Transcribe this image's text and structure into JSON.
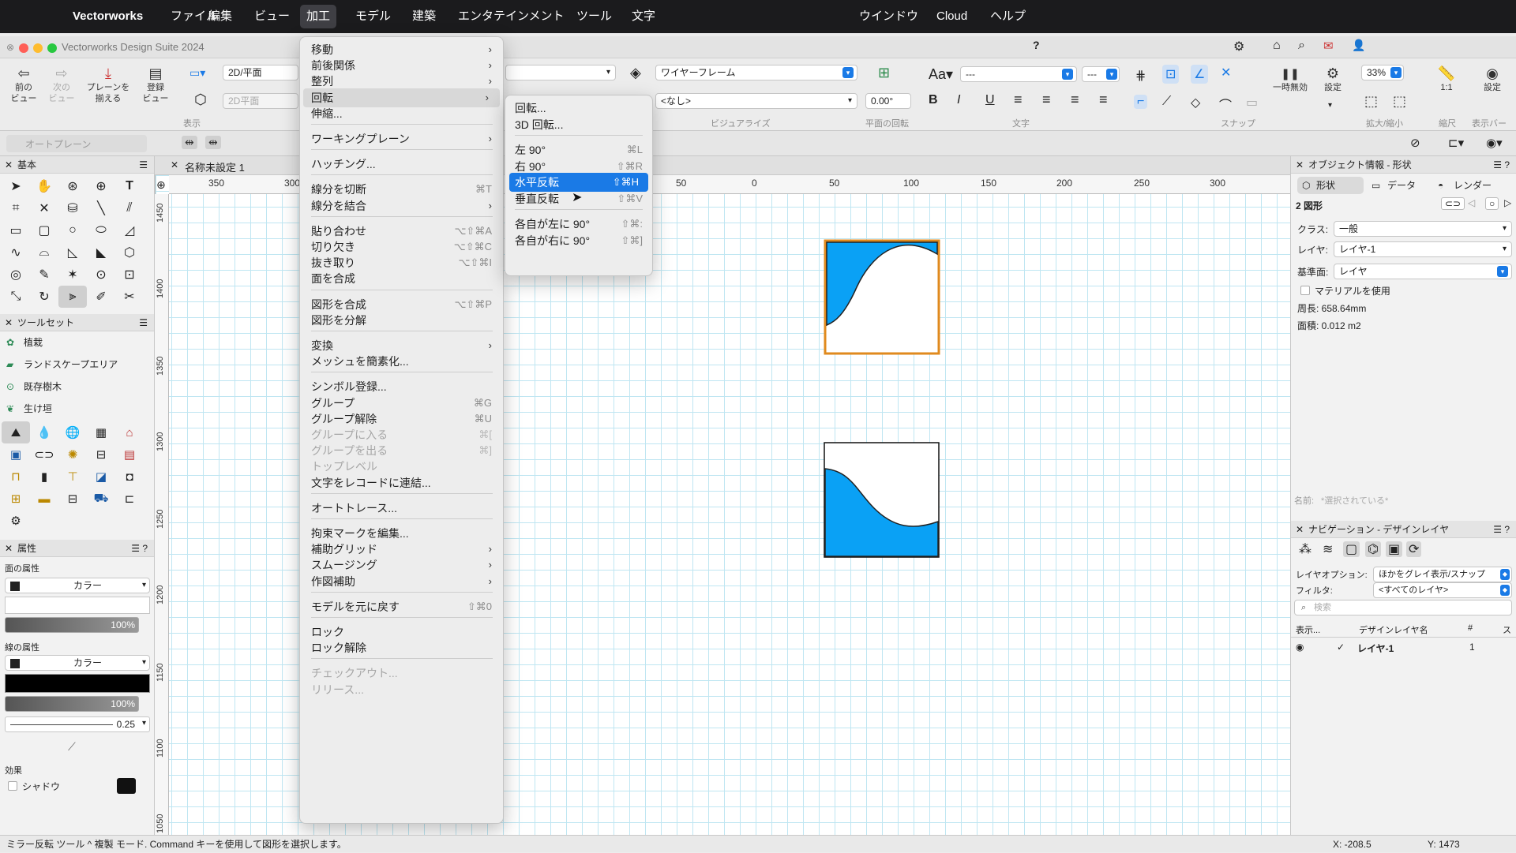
{
  "menubar": {
    "app": "Vectorworks",
    "items": [
      "ファイル",
      "編集",
      "ビュー",
      "加工",
      "モデル",
      "建築",
      "エンタテインメント",
      "ツール",
      "文字"
    ],
    "right": [
      "ウインドウ",
      "Cloud",
      "ヘルプ"
    ]
  },
  "window": {
    "title": "Vectorworks Design Suite 2024",
    "help": "?"
  },
  "toolbar": {
    "prev_view": "前の\nビュー",
    "next_view": "次の\nビュー",
    "align_plane": "プレーンを\n揃える",
    "save_view": "登録\nビュー",
    "view_mode": "2D/平面",
    "view_mode2": "2D平面",
    "section_view": "表示",
    "render_mode": "ワイヤーフレーム",
    "none_option": "<なし>",
    "rotation": "0.00°",
    "section_visualize": "ビジュアライズ",
    "section_plane_rot": "平面の回転",
    "font_dropdown": "---",
    "font_size": "---",
    "section_text": "文字",
    "section_snap": "スナップ",
    "pause_label": "一時無効",
    "settings_label": "設定",
    "zoom": "33%",
    "section_zoom": "拡大/縮小",
    "ratio": "1:1",
    "section_scale": "縮尺",
    "section_display": "表示バー",
    "settings2": "設定",
    "auto_plane": "オートプレーン"
  },
  "canvas": {
    "tab_title": "名称未設定 1",
    "ruler_top": [
      "350",
      "300",
      "50",
      "0",
      "50",
      "100",
      "150",
      "200",
      "250",
      "300"
    ],
    "ruler_left": [
      "1450",
      "1400",
      "1350",
      "1300",
      "1250",
      "1200",
      "1150",
      "1100",
      "1050"
    ]
  },
  "left_panel": {
    "basic_title": "基本",
    "toolset_title": "ツールセット",
    "toolsets": [
      "植栽",
      "ランドスケープエリア",
      "既存樹木",
      "生け垣"
    ],
    "attr_title": "属性",
    "fill_label": "面の属性",
    "fill_type": "カラー",
    "fill_opacity": "100%",
    "line_label": "線の属性",
    "line_type": "カラー",
    "line_opacity": "100%",
    "line_weight": "0.25",
    "effects_label": "効果",
    "shadow_label": "シャドウ"
  },
  "edit_menu": {
    "items": [
      {
        "label": "移動",
        "submenu": true
      },
      {
        "label": "前後関係",
        "submenu": true
      },
      {
        "label": "整列",
        "submenu": true
      },
      {
        "label": "回転",
        "submenu": true,
        "highlight": true
      },
      {
        "label": "伸縮..."
      },
      {
        "sep": true
      },
      {
        "label": "ワーキングプレーン",
        "submenu": true
      },
      {
        "sep": true
      },
      {
        "label": "ハッチング..."
      },
      {
        "sep": true
      },
      {
        "label": "線分を切断",
        "shortcut": "⌘T"
      },
      {
        "label": "線分を結合",
        "submenu": true
      },
      {
        "sep": true
      },
      {
        "label": "貼り合わせ",
        "shortcut": "⌥⇧⌘A"
      },
      {
        "label": "切り欠き",
        "shortcut": "⌥⇧⌘C"
      },
      {
        "label": "抜き取り",
        "shortcut": "⌥⇧⌘I"
      },
      {
        "label": "面を合成"
      },
      {
        "sep": true
      },
      {
        "label": "図形を合成",
        "shortcut": "⌥⇧⌘P"
      },
      {
        "label": "図形を分解"
      },
      {
        "sep": true
      },
      {
        "label": "変換",
        "submenu": true
      },
      {
        "label": "メッシュを簡素化..."
      },
      {
        "sep": true
      },
      {
        "label": "シンボル登録..."
      },
      {
        "label": "グループ",
        "shortcut": "⌘G"
      },
      {
        "label": "グループ解除",
        "shortcut": "⌘U"
      },
      {
        "label": "グループに入る",
        "shortcut": "⌘[",
        "disabled": true
      },
      {
        "label": "グループを出る",
        "shortcut": "⌘]",
        "disabled": true
      },
      {
        "label": "トップレベル",
        "disabled": true
      },
      {
        "label": "文字をレコードに連結..."
      },
      {
        "sep": true
      },
      {
        "label": "オートトレース..."
      },
      {
        "sep": true
      },
      {
        "label": "拘束マークを編集..."
      },
      {
        "label": "補助グリッド",
        "submenu": true
      },
      {
        "label": "スムージング",
        "submenu": true
      },
      {
        "label": "作図補助",
        "submenu": true
      },
      {
        "sep": true
      },
      {
        "label": "モデルを元に戻す",
        "shortcut": "⇧⌘0"
      },
      {
        "sep": true
      },
      {
        "label": "ロック"
      },
      {
        "label": "ロック解除"
      },
      {
        "sep": true
      },
      {
        "label": "チェックアウト...",
        "disabled": true
      },
      {
        "label": "リリース...",
        "disabled": true
      }
    ]
  },
  "rotate_submenu": {
    "items": [
      {
        "label": "回転..."
      },
      {
        "label": "3D 回転..."
      },
      {
        "sep": true
      },
      {
        "label": "左 90°",
        "shortcut": "⌘L"
      },
      {
        "label": "右 90°",
        "shortcut": "⇧⌘R"
      },
      {
        "label": "水平反転",
        "shortcut": "⇧⌘H",
        "highlight": true
      },
      {
        "label": "垂直反転",
        "shortcut": "⇧⌘V"
      },
      {
        "sep": true
      },
      {
        "label": "各自が左に 90°",
        "shortcut": "⇧⌘:"
      },
      {
        "label": "各自が右に 90°",
        "shortcut": "⇧⌘]"
      }
    ]
  },
  "right_panel": {
    "oi_title": "オブジェクト情報 - 形状",
    "tabs": [
      "形状",
      "データ",
      "レンダー"
    ],
    "selection": "2 図形",
    "class_label": "クラス:",
    "class_value": "一般",
    "layer_label": "レイヤ:",
    "layer_value": "レイヤ-1",
    "plane_label": "基準面:",
    "plane_value": "レイヤ",
    "material_label": "マテリアルを使用",
    "perimeter": "周長:   658.64mm",
    "area": "面積:   0.012 m2",
    "name_label": "名前:",
    "name_placeholder": "*選択されている*",
    "nav_title": "ナビゲーション - デザインレイヤ",
    "layer_options_label": "レイヤオプション:",
    "layer_options_value": "ほかをグレイ表示/スナップ",
    "filter_label": "フィルタ:",
    "filter_value": "<すべてのレイヤ>",
    "search_placeholder": "検索",
    "col_display": "表示...",
    "col_name": "デザインレイヤ名",
    "col_num": "#",
    "col_s": "ス",
    "layer_row_name": "レイヤ-1",
    "layer_row_num": "1"
  },
  "status": {
    "tool_mode": "ミラー反転 ツール  ^  複製 モード. Command キーを使用して図形を選択します。",
    "x": "X: -208.5",
    "y": "Y: 1473"
  },
  "colors": {
    "accent": "#1a7ae6",
    "shape_fill": "#0aa1f5",
    "selection_orange": "#e08a1e"
  }
}
